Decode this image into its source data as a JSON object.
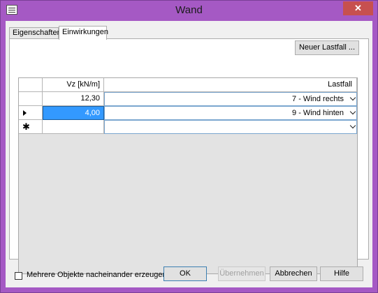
{
  "window": {
    "title": "Wand",
    "close_label": "✕"
  },
  "tabs": [
    {
      "label": "Eigenschaften"
    },
    {
      "label": "Einwirkungen"
    }
  ],
  "toolbar": {
    "new_loadcase_label": "Neuer Lastfall ..."
  },
  "grid": {
    "columns": {
      "vz": "Vz [kN/m]",
      "lastfall": "Lastfall"
    },
    "rows": [
      {
        "vz": "12,30",
        "lastfall": "7 - Wind rechts"
      },
      {
        "vz": "4,00",
        "lastfall": "9 - Wind hinten"
      },
      {
        "vz": "",
        "lastfall": ""
      }
    ]
  },
  "footer": {
    "checkbox_label": "Mehrere Objekte nacheinander erzeugen",
    "checkbox_checked": false,
    "ok_label": "OK",
    "apply_label": "Übernehmen",
    "cancel_label": "Abbrechen",
    "help_label": "Hilfe"
  }
}
